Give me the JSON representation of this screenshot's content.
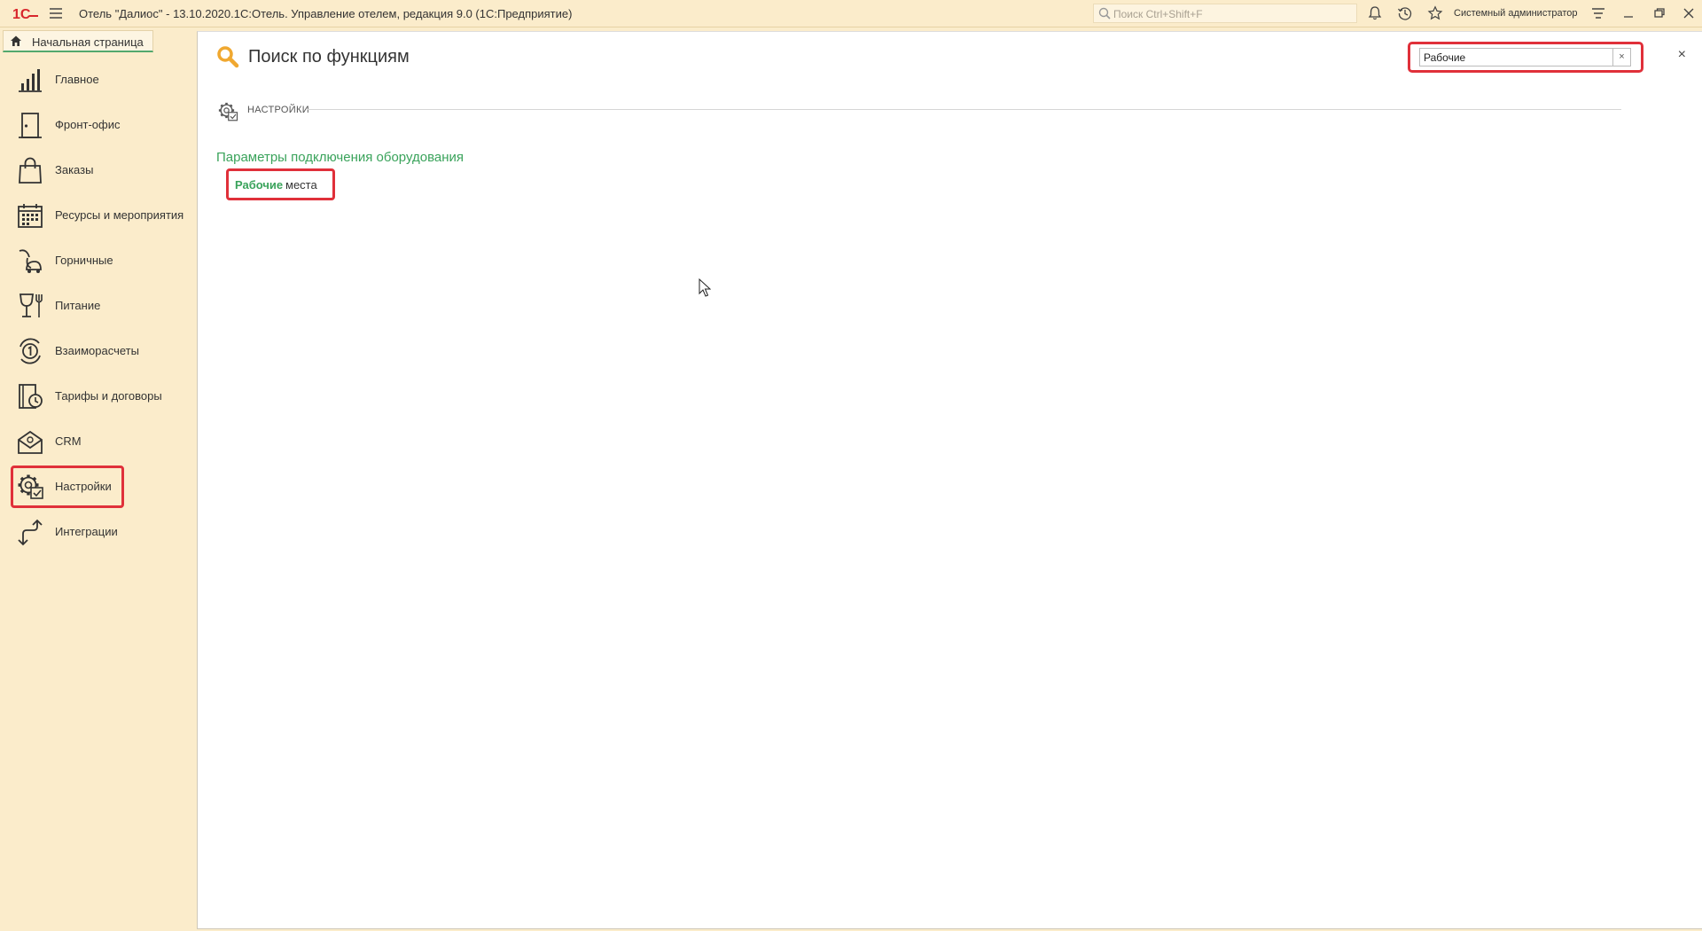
{
  "titlebar": {
    "title": "Отель \"Далиос\" - 13.10.2020.1С:Отель. Управление отелем, редакция 9.0  (1С:Предприятие)",
    "search_placeholder": "Поиск Ctrl+Shift+F",
    "user": "Системный администратор"
  },
  "home_tab": {
    "label": "Начальная страница"
  },
  "sidebar": {
    "items": [
      {
        "label": "Главное"
      },
      {
        "label": "Фронт-офис"
      },
      {
        "label": "Заказы"
      },
      {
        "label": "Ресурсы и мероприятия"
      },
      {
        "label": "Горничные"
      },
      {
        "label": "Питание"
      },
      {
        "label": "Взаиморасчеты"
      },
      {
        "label": "Тарифы и договоры"
      },
      {
        "label": "CRM"
      },
      {
        "label": "Настройки",
        "active": true
      },
      {
        "label": "Интеграции"
      }
    ]
  },
  "panel": {
    "title": "Поиск по функциям",
    "search_value": "Рабочие",
    "clear_label": "×",
    "close_label": "×",
    "section_label": "НАСТРОЙКИ",
    "group_title": "Параметры подключения оборудования",
    "result": {
      "match": "Рабочие",
      "rest": "места"
    }
  },
  "colors": {
    "background": "#fbeccb",
    "accent_green": "#3aa35b",
    "highlight_red": "#e0303a",
    "search_icon": "#f0a830"
  }
}
